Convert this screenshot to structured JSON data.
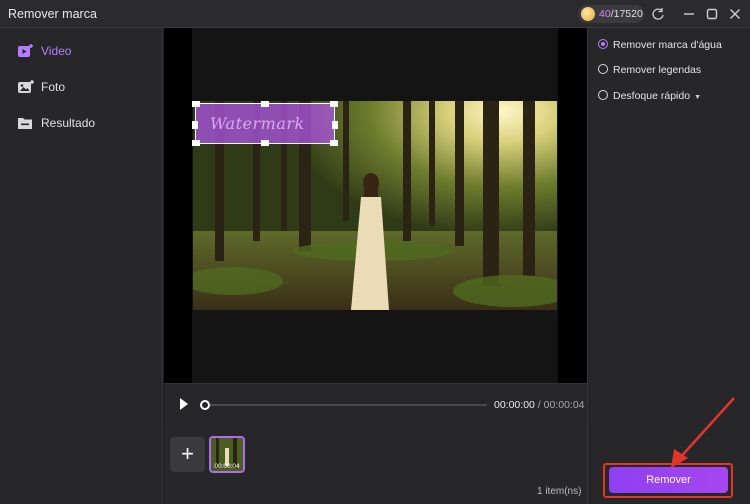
{
  "window": {
    "title": "Remover marca"
  },
  "credits": {
    "used": "40",
    "total": "/17520",
    "icon": "coin-icon"
  },
  "titlebar_icons": [
    "refresh-icon",
    "minimize-icon",
    "maximize-icon",
    "close-icon"
  ],
  "sidebar": {
    "items": [
      {
        "label": "Video",
        "icon": "video-icon",
        "active": true
      },
      {
        "label": "Foto",
        "icon": "photo-icon",
        "active": false
      },
      {
        "label": "Resultado",
        "icon": "folder-icon",
        "active": false
      }
    ]
  },
  "player": {
    "current": "00:00:00",
    "separator": "/",
    "duration": "00:00:04",
    "progress": 0
  },
  "thumbnails": [
    {
      "label": "00:00:04"
    }
  ],
  "list": {
    "count": "1 item(ns)"
  },
  "options": [
    {
      "label": "Remover marca d'água",
      "selected": true
    },
    {
      "label": "Remover legendas",
      "selected": false
    },
    {
      "label": "Desfoque rápido",
      "selected": false,
      "has_dropdown": true
    }
  ],
  "actions": {
    "remove_label": "Remover"
  },
  "colors": {
    "accent": "#b77cff",
    "button": "#9a43f1",
    "highlight": "#e0352b"
  }
}
